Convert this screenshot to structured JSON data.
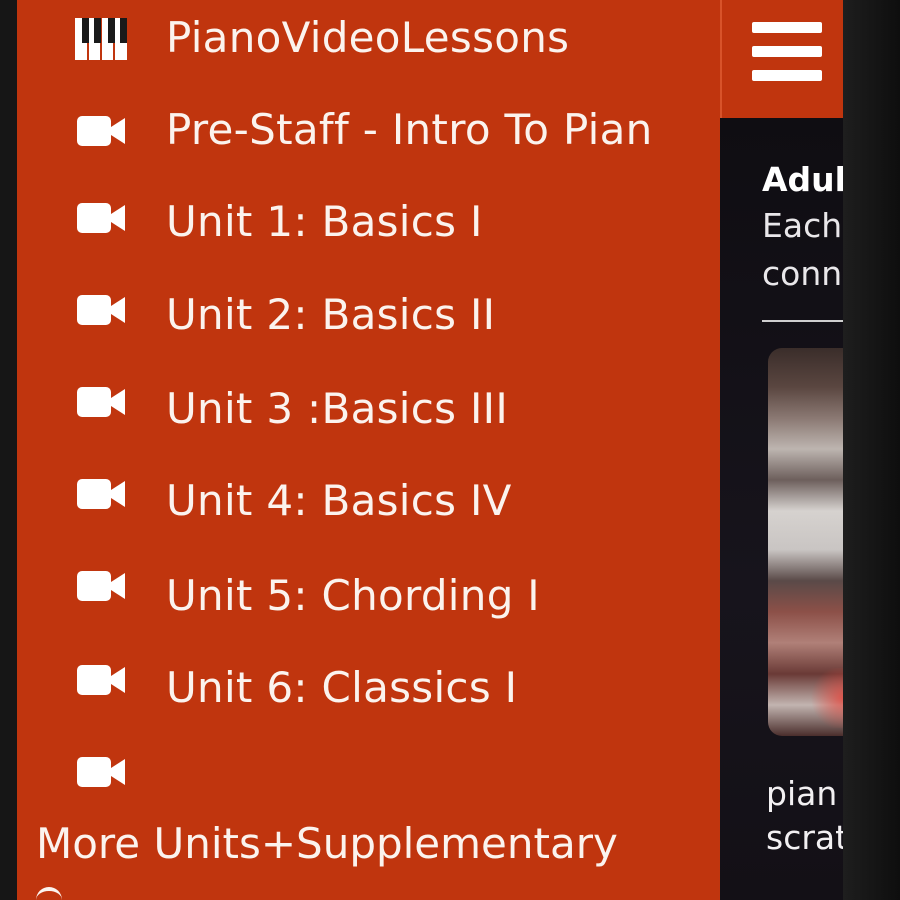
{
  "drawer": {
    "background_color": "#c0350e",
    "items": [
      {
        "label": "PianoVideoLessons",
        "icon": "piano-keys-icon"
      },
      {
        "label": "Pre-Staff - Intro To Pian",
        "icon": "video-camera-icon"
      },
      {
        "label": "Unit 1: Basics I",
        "icon": "video-camera-icon"
      },
      {
        "label": "Unit 2: Basics II",
        "icon": "video-camera-icon"
      },
      {
        "label": "Unit 3 :Basics III",
        "icon": "video-camera-icon"
      },
      {
        "label": "Unit 4: Basics IV",
        "icon": "video-camera-icon"
      },
      {
        "label": "Unit 5: Chording I",
        "icon": "video-camera-icon"
      },
      {
        "label": "Unit 6: Classics I",
        "icon": "video-camera-icon"
      }
    ],
    "more_item": {
      "label": "More Units+Supplementary",
      "icon": "video-camera-icon"
    }
  },
  "header": {
    "menu_icon": "hamburger-menu-icon",
    "background_color": "#c0350e"
  },
  "content": {
    "heading": "Adul",
    "lines": [
      "Each",
      "conn"
    ],
    "caption_lines": [
      "pian",
      "scrat"
    ]
  }
}
